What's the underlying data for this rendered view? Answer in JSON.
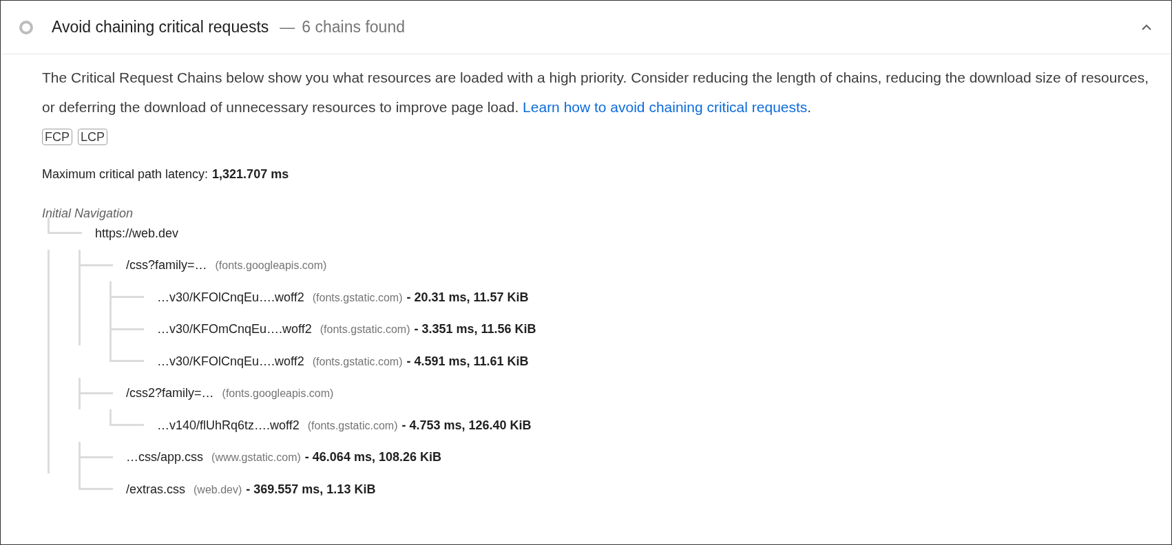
{
  "audit": {
    "title": "Avoid chaining critical requests",
    "separator": "—",
    "summary": "6 chains found",
    "expanded": true
  },
  "description": {
    "text": "The Critical Request Chains below show you what resources are loaded with a high priority. Consider reducing the length of chains, reducing the download size of resources, or deferring the download of unnecessary resources to improve page load.",
    "link": "Learn how to avoid chaining critical requests",
    "after_link": ".",
    "badges": [
      "FCP",
      "LCP"
    ]
  },
  "latency": {
    "label": "Maximum critical path latency:",
    "value": "1,321.707 ms"
  },
  "tree": {
    "heading": "Initial Navigation",
    "nodes": [
      {
        "url": "https://web.dev",
        "children": [
          {
            "url": "/css?family=…",
            "host": "(fonts.googleapis.com)",
            "children": [
              {
                "url": "…v30/KFOlCnqEu….woff2",
                "host": "(fonts.gstatic.com)",
                "stats": "- 20.31 ms, 11.57 KiB"
              },
              {
                "url": "…v30/KFOmCnqEu….woff2",
                "host": "(fonts.gstatic.com)",
                "stats": "- 3.351 ms, 11.56 KiB"
              },
              {
                "url": "…v30/KFOlCnqEu….woff2",
                "host": "(fonts.gstatic.com)",
                "stats": "- 4.591 ms, 11.61 KiB"
              }
            ]
          },
          {
            "url": "/css2?family=…",
            "host": "(fonts.googleapis.com)",
            "children": [
              {
                "url": "…v140/flUhRq6tz….woff2",
                "host": "(fonts.gstatic.com)",
                "stats": "- 4.753 ms, 126.40 KiB"
              }
            ]
          },
          {
            "url": "…css/app.css",
            "host": "(www.gstatic.com)",
            "stats": "- 46.064 ms, 108.26 KiB"
          },
          {
            "url": "/extras.css",
            "host": "(web.dev)",
            "stats": "- 369.557 ms, 1.13 KiB"
          }
        ]
      }
    ]
  }
}
